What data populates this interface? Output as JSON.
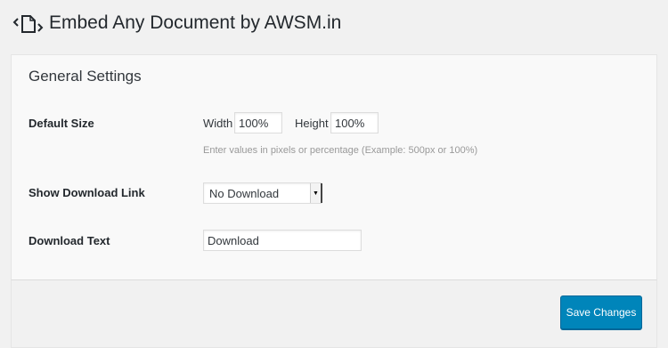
{
  "header": {
    "title": "Embed Any Document by AWSM.in",
    "logo_icon": "document-embed-icon"
  },
  "section": {
    "title": "General Settings"
  },
  "default_size": {
    "label": "Default Size",
    "width_label": "Width",
    "width_value": "100%",
    "height_label": "Height",
    "height_value": "100%",
    "help": "Enter values in pixels or percentage (Example: 500px or 100%)"
  },
  "download_link": {
    "label": "Show Download Link",
    "selected": "No Download",
    "arrow_icon": "select-arrow-icon"
  },
  "download_text": {
    "label": "Download Text",
    "value": "Download"
  },
  "footer": {
    "save_label": "Save Changes"
  },
  "colors": {
    "primary_button": "#0085ba",
    "background": "#f1f1f1",
    "panel": "#f9f9f9"
  }
}
